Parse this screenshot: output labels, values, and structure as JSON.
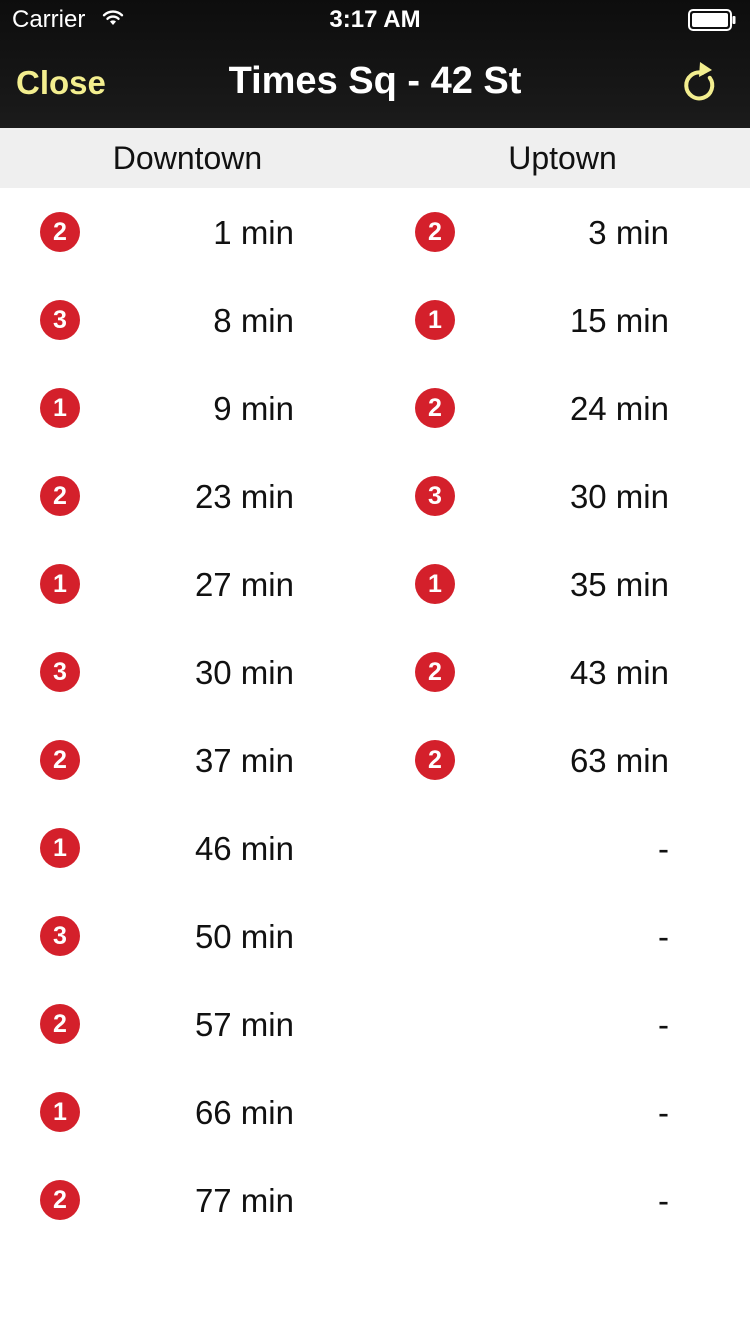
{
  "status_bar": {
    "carrier": "Carrier",
    "time": "3:17 AM"
  },
  "nav": {
    "close_label": "Close",
    "title": "Times Sq - 42 St"
  },
  "columns": {
    "downtown": "Downtown",
    "uptown": "Uptown"
  },
  "colors": {
    "accent": "#f3ee8f",
    "route_badge": "#d4202b",
    "header_bg": "#efefef"
  },
  "rows": [
    {
      "down": {
        "route": "2",
        "time": "1 min"
      },
      "up": {
        "route": "2",
        "time": "3 min"
      }
    },
    {
      "down": {
        "route": "3",
        "time": "8 min"
      },
      "up": {
        "route": "1",
        "time": "15 min"
      }
    },
    {
      "down": {
        "route": "1",
        "time": "9 min"
      },
      "up": {
        "route": "2",
        "time": "24 min"
      }
    },
    {
      "down": {
        "route": "2",
        "time": "23 min"
      },
      "up": {
        "route": "3",
        "time": "30 min"
      }
    },
    {
      "down": {
        "route": "1",
        "time": "27 min"
      },
      "up": {
        "route": "1",
        "time": "35 min"
      }
    },
    {
      "down": {
        "route": "3",
        "time": "30 min"
      },
      "up": {
        "route": "2",
        "time": "43 min"
      }
    },
    {
      "down": {
        "route": "2",
        "time": "37 min"
      },
      "up": {
        "route": "2",
        "time": "63 min"
      }
    },
    {
      "down": {
        "route": "1",
        "time": "46 min"
      },
      "up": {
        "route": null,
        "time": "-"
      }
    },
    {
      "down": {
        "route": "3",
        "time": "50 min"
      },
      "up": {
        "route": null,
        "time": "-"
      }
    },
    {
      "down": {
        "route": "2",
        "time": "57 min"
      },
      "up": {
        "route": null,
        "time": "-"
      }
    },
    {
      "down": {
        "route": "1",
        "time": "66 min"
      },
      "up": {
        "route": null,
        "time": "-"
      }
    },
    {
      "down": {
        "route": "2",
        "time": "77 min"
      },
      "up": {
        "route": null,
        "time": "-"
      }
    }
  ]
}
